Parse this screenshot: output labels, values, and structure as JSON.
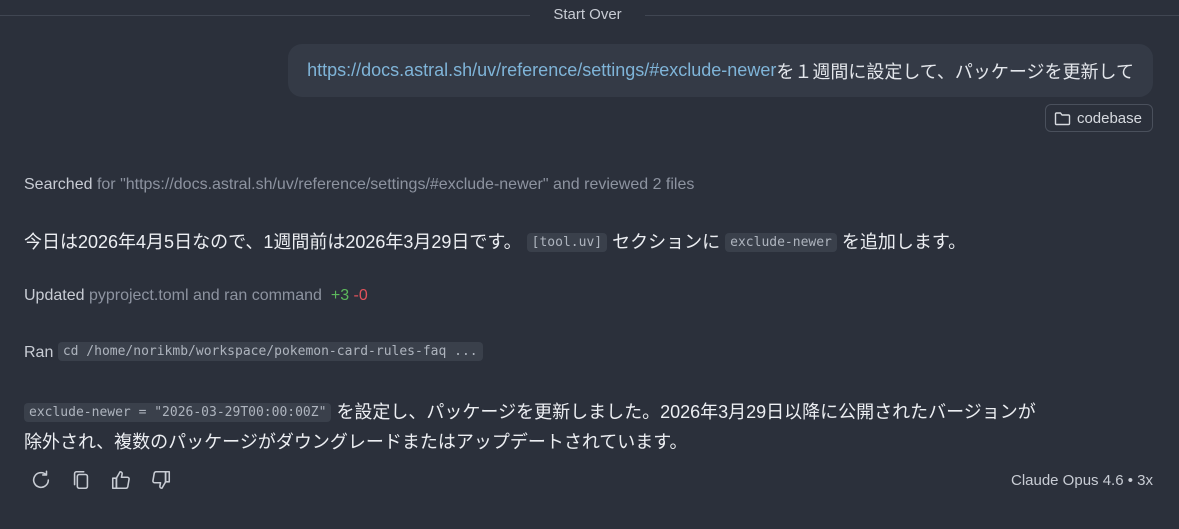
{
  "header": {
    "start_over_label": "Start Over"
  },
  "user_message": {
    "link_text": "https://docs.astral.sh/uv/reference/settings/#exclude-newer",
    "text": " を１週間に設定して、パッケージを更新して",
    "context_chip_label": "codebase",
    "context_chip_icon": "folder-icon"
  },
  "assistant": {
    "searched": {
      "verb": "Searched",
      "detail": " for \"https://docs.astral.sh/uv/reference/settings/#exclude-newer\" and reviewed 2 files"
    },
    "para1": {
      "text_a": "今日は2026年4月5日なので、1週間前は2026年3月29日です。",
      "code_a": "[tool.uv]",
      "text_b": "セクションに",
      "code_b": "exclude-newer",
      "text_c": "を追加します。"
    },
    "updated": {
      "verb": "Updated",
      "detail": " pyproject.toml and ran command",
      "added": "+3",
      "removed": "-0"
    },
    "ran": {
      "verb": "Ran",
      "command": "cd /home/norikmb/workspace/pokemon-card-rules-faq ..."
    },
    "para2": {
      "code": "exclude-newer = \"2026-03-29T00:00:00Z\"",
      "text_line1": "を設定し、パッケージを更新しました。2026年3月29日以降に公開されたバージョンが",
      "text_line2": "除外され、複数のパッケージがダウングレードまたはアップデートされています。"
    },
    "actions": [
      "retry-icon",
      "copy-icon",
      "thumbs-up-icon",
      "thumbs-down-icon"
    ],
    "model_info": "Claude Opus 4.6 • 3x"
  },
  "colors": {
    "background": "#2b303b",
    "bubble": "#343a46",
    "link": "#7fb4d8",
    "added": "#5cb85c",
    "removed": "#e0525b"
  }
}
